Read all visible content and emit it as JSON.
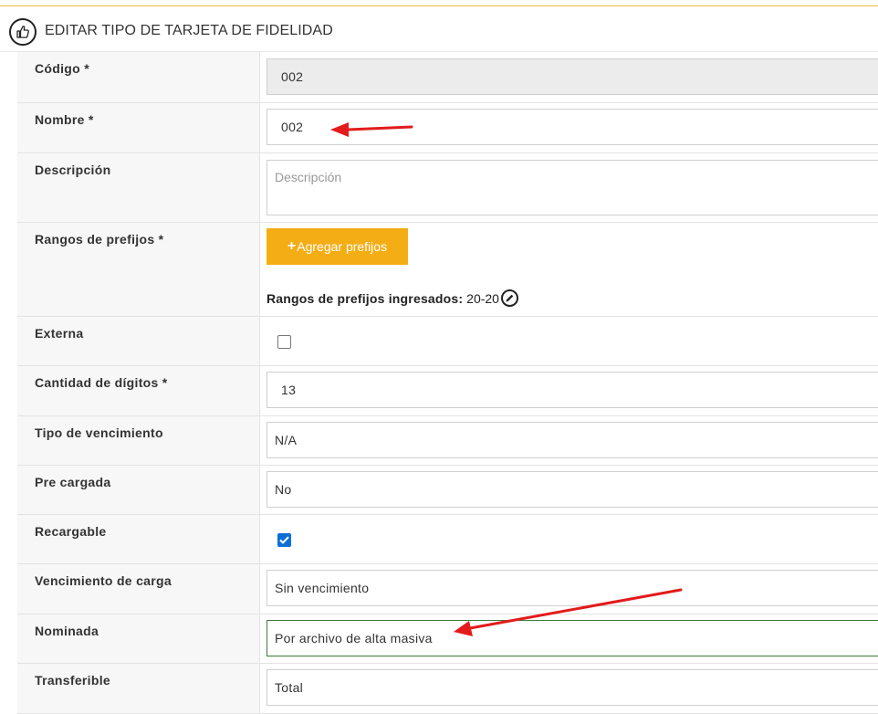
{
  "header": {
    "title": "EDITAR TIPO DE TARJETA DE FIDELIDAD",
    "icon": "thumbs-up-icon"
  },
  "colors": {
    "accent": "#f4ad14",
    "checkbox": "#0b6fd6",
    "arrow": "#e31b1b"
  },
  "fields": {
    "codigo": {
      "label": "Código *",
      "value": "002"
    },
    "nombre": {
      "label": "Nombre *",
      "value": "002"
    },
    "descripcion": {
      "label": "Descripción",
      "placeholder": "Descripción"
    },
    "rangos": {
      "label": "Rangos de prefijos *",
      "button_label": "Agregar prefijos",
      "button_icon": "+",
      "info_label": "Rangos de prefijos ingresados:",
      "info_value": "20-20"
    },
    "externa": {
      "label": "Externa",
      "checked": false
    },
    "cantidad": {
      "label": "Cantidad de dígitos *",
      "value": "13"
    },
    "tipo_vencimiento": {
      "label": "Tipo de vencimiento",
      "value": "N/A"
    },
    "pre_cargada": {
      "label": "Pre cargada",
      "value": "No"
    },
    "recargable": {
      "label": "Recargable",
      "checked": true
    },
    "vencimiento_carga": {
      "label": "Vencimiento de carga",
      "value": "Sin vencimiento"
    },
    "nominada": {
      "label": "Nominada",
      "value": "Por archivo de alta masiva"
    },
    "transferible": {
      "label": "Transferible",
      "value": "Total"
    }
  }
}
